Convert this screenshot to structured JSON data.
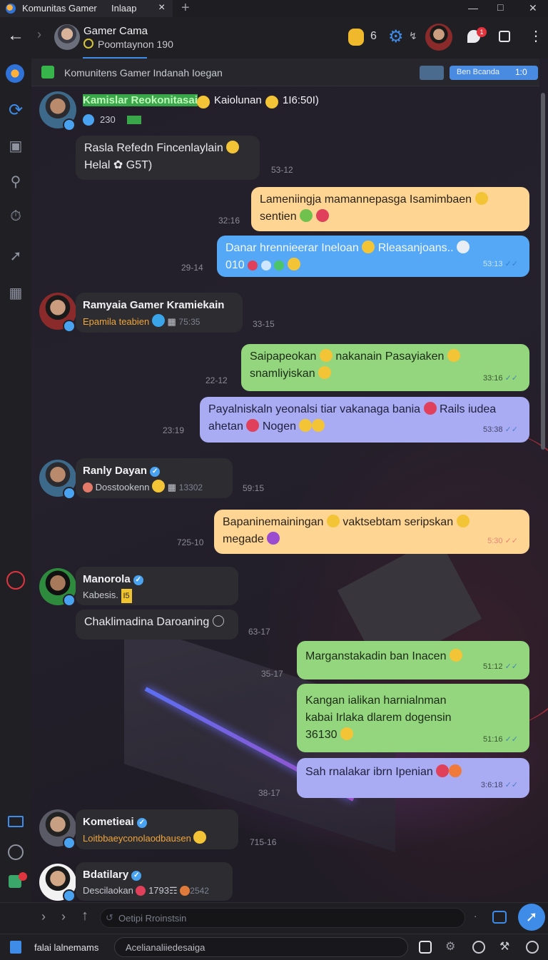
{
  "titlebar": {
    "tab1": "Komunitas Gamer",
    "tab2": "Inlaap",
    "close_tab": "×",
    "new_tab": "+"
  },
  "header": {
    "title": "Gamer Cama",
    "subtitle": "Poomtaynon 190",
    "count": "6",
    "notif_count": "1"
  },
  "banner": {
    "label": "Komunitens Gamer Indanah Ioegan",
    "right_badge": "Ben Bcanda",
    "right_level": "1:0"
  },
  "messages": [
    {
      "kind": "incoming-head",
      "name": "Kamislar Reokonitasai",
      "name_tail": "Kaiolunan",
      "name_count": "1I6:50I)",
      "sub": "230"
    },
    {
      "kind": "incoming",
      "line1": "Rasla Refedn Fincenlaylain",
      "line2": "Helal",
      "line2_tail": "G5T)",
      "time": "53-12"
    },
    {
      "kind": "peach",
      "line1": "Lameniingja mamannepasga Isamimbaen",
      "line2": "sentien",
      "time": "32:16"
    },
    {
      "kind": "blue",
      "line1": "Danar hrennieerar Ineloan",
      "line1_tail": "Rleasanjoans..",
      "line2": "010",
      "time": "29-14",
      "inner_time": "53:13"
    },
    {
      "kind": "incoming-head",
      "name": "Ramyaia Gamer Kramiekain",
      "sub": "Epamila teabien",
      "sub_tail": "75:35",
      "time": "33-15"
    },
    {
      "kind": "green",
      "line1": "Saipapeokan",
      "line1_mid": "nakanain Pasayiaken",
      "line2": "snamliyiskan",
      "time": "22-12",
      "inner_time": "33:16"
    },
    {
      "kind": "lav",
      "line1": "Payalniskaln yeonalsi  tiar vakanaga  bania",
      "line1_tail": "Rails iudea",
      "line2": "ahetan",
      "line2_mid": "Nogen",
      "time": "23:19",
      "inner_time": "53:38"
    },
    {
      "kind": "incoming-head",
      "name": "Ranly Dayan",
      "sub": "Dosstookenn",
      "sub_tail": "13302",
      "time": "59:15"
    },
    {
      "kind": "peach",
      "line1": "Bapaninemainingan",
      "line1_tail": "vaktsebtam seripskan",
      "line2": "megade",
      "time": "725-10",
      "inner_time": "5:30"
    },
    {
      "kind": "incoming-head",
      "name": "Manorola",
      "sub": "Kabesis.",
      "sub_tail": "I5"
    },
    {
      "kind": "incoming",
      "line1": "Chaklimadina Daroaning",
      "time": "63-17"
    },
    {
      "kind": "green",
      "line1": "Marganstakadin ban Inacen",
      "time": "35-17",
      "inner_time": "51:12"
    },
    {
      "kind": "green",
      "line1": "Kangan ialikan harnialnman",
      "line2": "kabai Irlaka dlarem dogensin",
      "line3": "36130",
      "inner_time": "51:16"
    },
    {
      "kind": "lav",
      "line1": "Sah rnalakar ibrn Ipenian",
      "time": "38-17",
      "inner_time": "3:6:18"
    },
    {
      "kind": "incoming-head",
      "name": "Kometieai",
      "sub": "Loitbbaeyconolaodbausen",
      "time": "715-16"
    },
    {
      "kind": "incoming-head",
      "name": "Bdatilary",
      "sub": "Descilaokan",
      "sub_mid": "1793☶",
      "sub_tail": "2542"
    }
  ],
  "input": {
    "placeholder": "Oetipi Rroinstsin"
  },
  "taskbar": {
    "app_label": "falai lalnemams",
    "field_text": "Acelianaliiedesaiga"
  },
  "colors": {
    "accent": "#3f8ce8",
    "peach": "#ffd594",
    "blue": "#54a8f5",
    "green": "#93d67d",
    "lavender": "#a9acf2"
  },
  "icons": [
    "back-arrow-icon",
    "forward-chevron-icon",
    "coin-icon",
    "gear-icon",
    "bell-icon",
    "window-icon",
    "more-icon",
    "send-icon",
    "attach-icon"
  ]
}
